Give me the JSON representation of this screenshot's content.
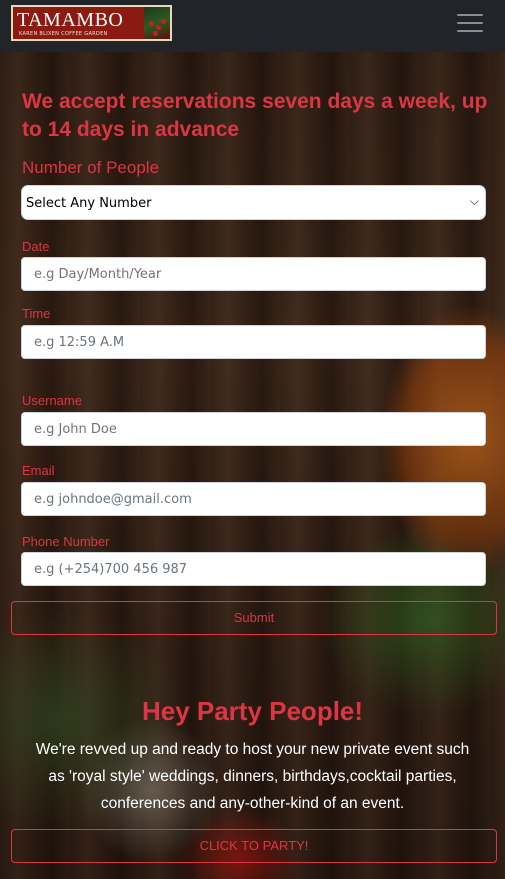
{
  "brand": {
    "name": "TAMAMBO",
    "tagline": "KAREN BLIXEN COFFEE GARDEN"
  },
  "nav": {
    "menu_icon": "hamburger-menu-icon"
  },
  "form": {
    "heading": "We accept reservations seven days a week, up to 14 days in advance",
    "people_label": "Number of People",
    "people_select_value": "Select Any Number",
    "date_label": "Date",
    "date_placeholder": "e.g Day/Month/Year",
    "time_label": "Time",
    "time_placeholder": "e.g 12:59 A.M",
    "username_label": "Username",
    "username_placeholder": "e.g John Doe",
    "email_label": "Email",
    "email_placeholder": "e.g johndoe@gmail.com",
    "phone_label": "Phone Number",
    "phone_placeholder": "e.g (+254)700 456 987",
    "submit_label": "Submit"
  },
  "party": {
    "title": "Hey Party People!",
    "text": "We're revved up and ready to host your new private event such as 'royal style' weddings, dinners, birthdays,cocktail parties, conferences and any-other-kind of an event.",
    "button_label": "CLICK TO PARTY!"
  },
  "colors": {
    "accent": "#dc3545",
    "navbar": "#212529"
  }
}
